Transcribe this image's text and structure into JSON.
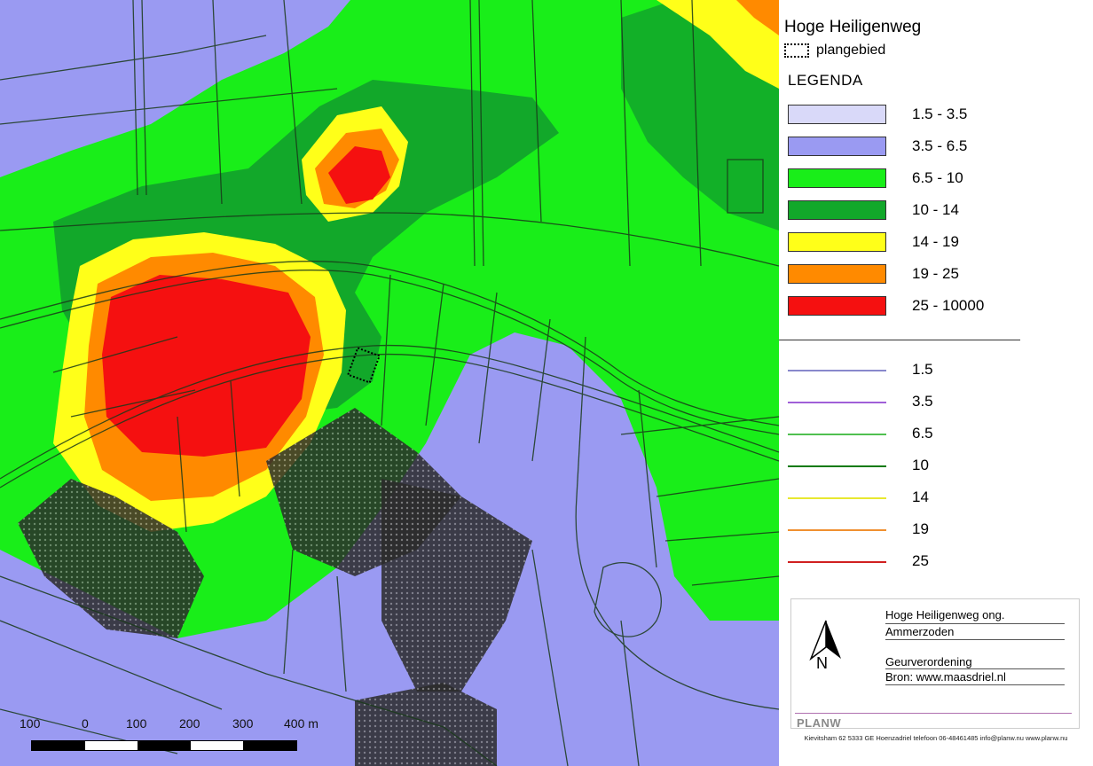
{
  "legend": {
    "title": "Hoge Heiligenweg",
    "plan_label": "plangebied",
    "heading": "LEGENDA",
    "classes": [
      {
        "label": "1.5 - 3.5",
        "color": "#d9d9f9"
      },
      {
        "label": "3.5 - 6.5",
        "color": "#9a9af2"
      },
      {
        "label": "6.5 - 10",
        "color": "#19ee19"
      },
      {
        "label": "10 - 14",
        "color": "#12a82a"
      },
      {
        "label": "14 - 19",
        "color": "#ffff19"
      },
      {
        "label": "19 - 25",
        "color": "#ff8a00"
      },
      {
        "label": "25 - 10000",
        "color": "#f51010"
      }
    ],
    "contours": [
      {
        "label": "1.5",
        "color": "#8888cc"
      },
      {
        "label": "3.5",
        "color": "#a060d8"
      },
      {
        "label": "6.5",
        "color": "#50c050"
      },
      {
        "label": "10",
        "color": "#0a7a0a"
      },
      {
        "label": "14",
        "color": "#e8e830"
      },
      {
        "label": "19",
        "color": "#f09030"
      },
      {
        "label": "25",
        "color": "#d02020"
      }
    ]
  },
  "info": {
    "line1": "Hoge Heiligenweg ong.",
    "line2": "Ammerzoden",
    "line3": "Geurverordening",
    "line4": "Bron: www.maasdriel.nl",
    "north_label": "N",
    "logo": "PLANW",
    "address": "Kievitsham 62 5333 GE Hoenzadriel telefoon 06-48461485 info@planw.nu www.planw.nu"
  },
  "scale": {
    "labels": [
      "100",
      "0",
      "100",
      "200",
      "300",
      "400 m"
    ]
  }
}
